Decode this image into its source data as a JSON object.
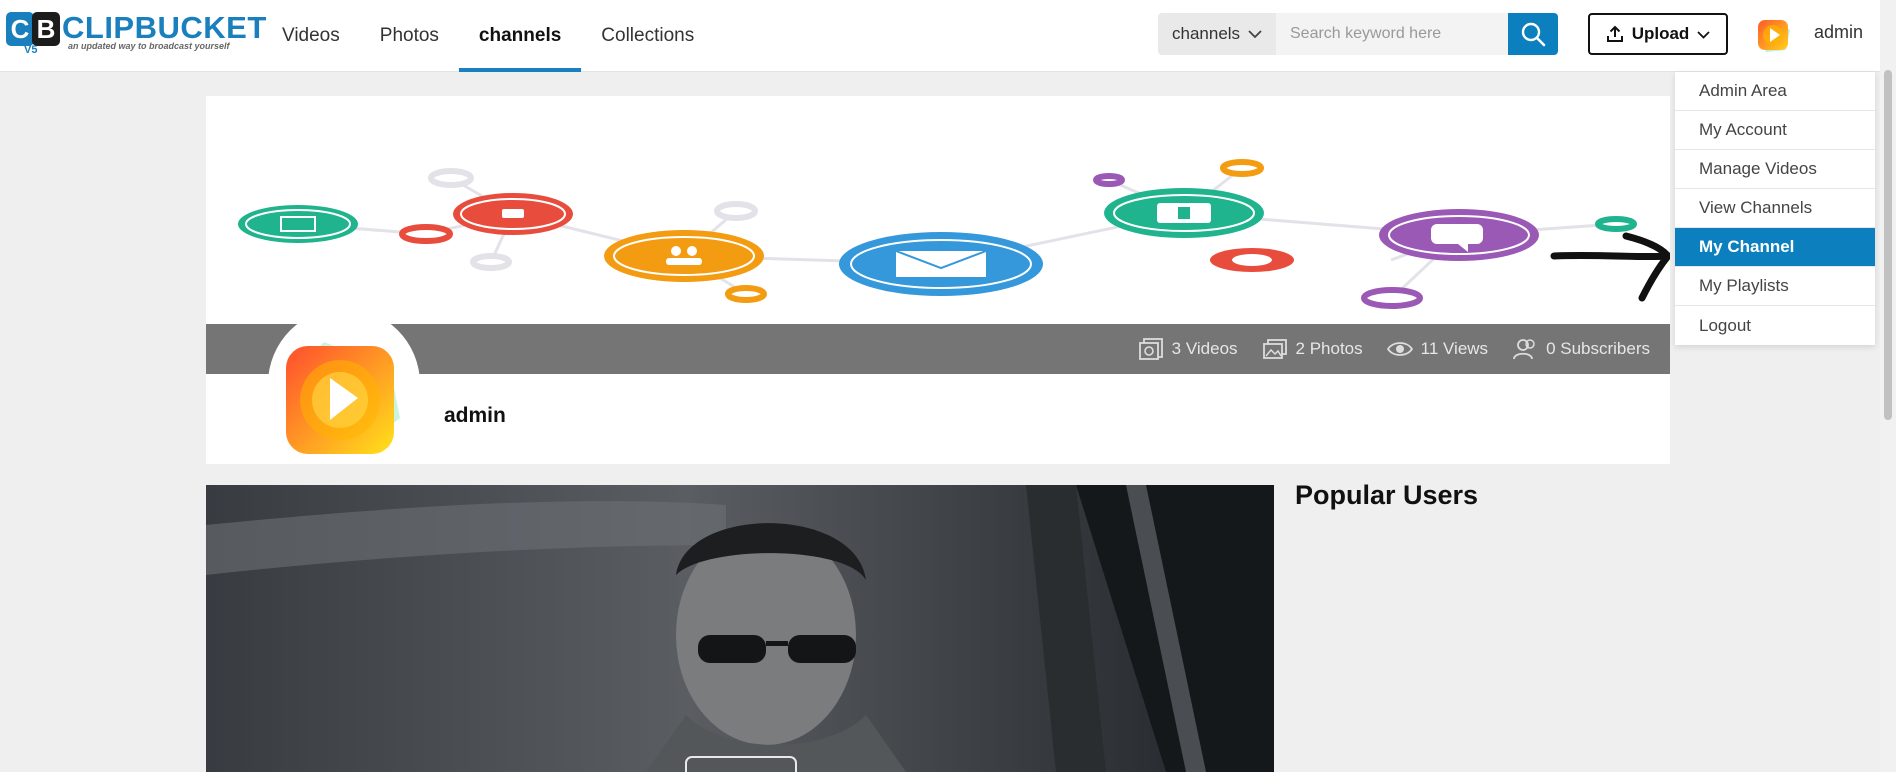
{
  "brand": {
    "logo_letters": "CB",
    "name": "CLIPBUCKET",
    "version": "V5",
    "tagline": "an updated way to broadcast yourself"
  },
  "nav": {
    "links": [
      {
        "label": "Videos"
      },
      {
        "label": "Photos"
      },
      {
        "label": "channels"
      },
      {
        "label": "Collections"
      }
    ]
  },
  "search": {
    "category": "channels",
    "placeholder": "Search keyword here"
  },
  "upload": {
    "label": "Upload"
  },
  "user": {
    "name": "admin"
  },
  "dropdown": {
    "items": [
      {
        "label": "Admin Area"
      },
      {
        "label": "My Account"
      },
      {
        "label": "Manage Videos"
      },
      {
        "label": "View Channels"
      },
      {
        "label": "My Channel"
      },
      {
        "label": "My Playlists"
      },
      {
        "label": "Logout"
      }
    ]
  },
  "channel": {
    "name": "admin",
    "stats": {
      "videos": "3 Videos",
      "photos": "2 Photos",
      "views": "11 Views",
      "subscribers": "0 Subscribers"
    }
  },
  "sidebar": {
    "popular_title": "Popular Users"
  },
  "colors": {
    "accent": "#0c7fbf",
    "teal": "#1fb38e",
    "red": "#e84c3d",
    "orange": "#f39c12",
    "blue": "#3498db",
    "purple": "#9b59b6"
  }
}
